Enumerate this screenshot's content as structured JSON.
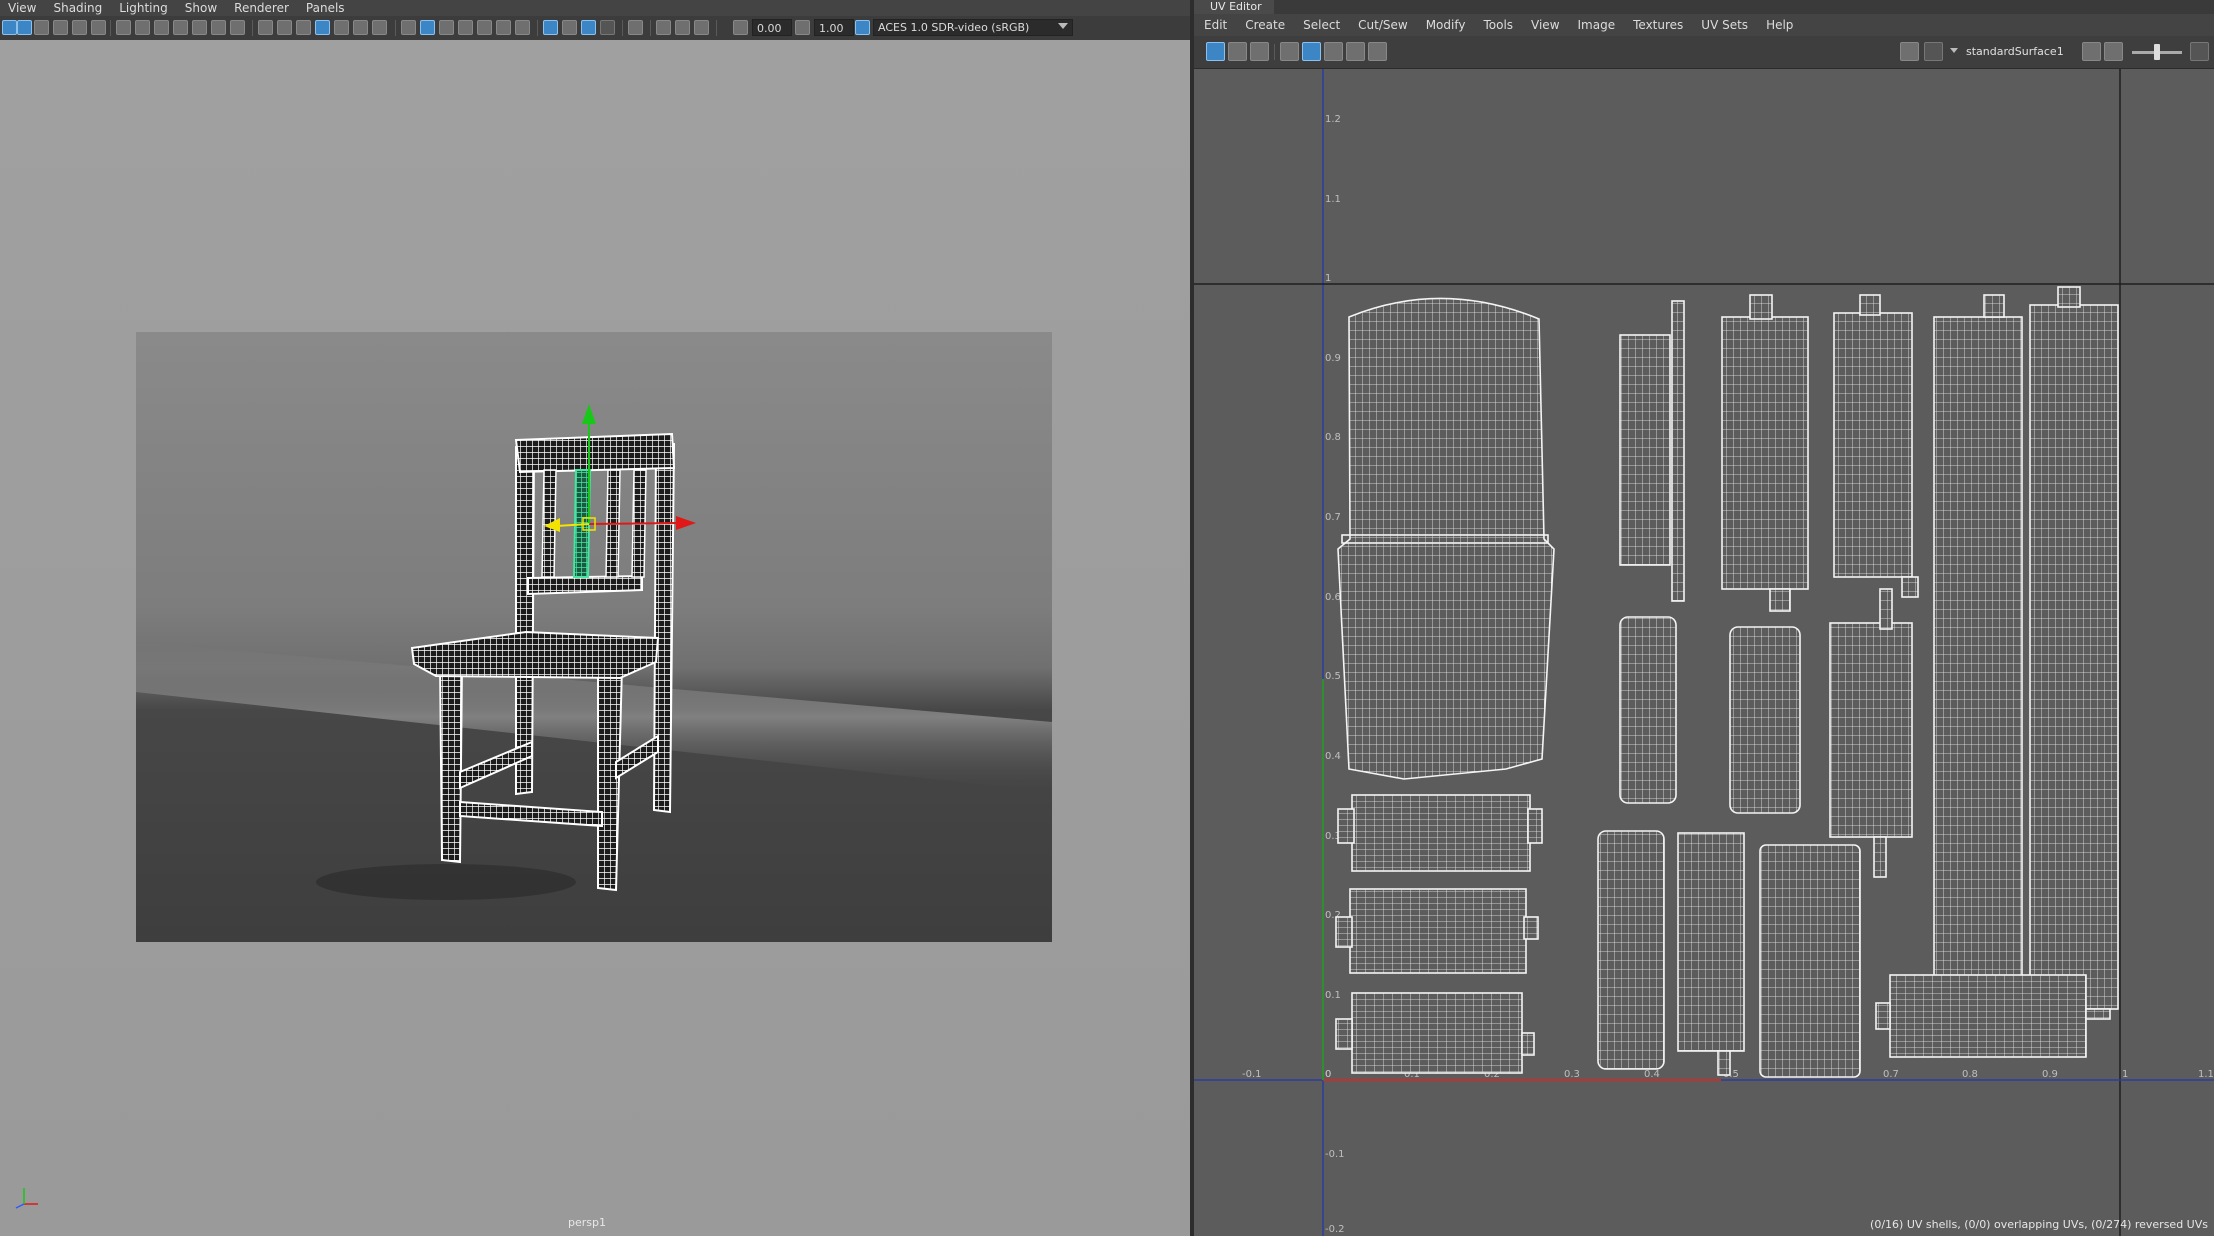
{
  "viewport": {
    "menus": [
      "View",
      "Shading",
      "Lighting",
      "Show",
      "Renderer",
      "Panels"
    ],
    "exposure_value": "0.00",
    "gamma_value": "1.00",
    "colorspace_label": "ACES 1.0 SDR-video (sRGB)",
    "camera_label": "persp1"
  },
  "uv_editor": {
    "title": "UV Editor",
    "menus": [
      "Edit",
      "Create",
      "Select",
      "Cut/Sew",
      "Modify",
      "Tools",
      "View",
      "Image",
      "Textures",
      "UV Sets",
      "Help"
    ],
    "shader_name": "standardSurface1",
    "u_axis_labels": [
      "-0.1",
      "0",
      "0.1",
      "0.2",
      "0.3",
      "0.4",
      "0.5",
      "0.6",
      "0.7",
      "0.8",
      "0.9",
      "1",
      "1.1"
    ],
    "v_axis_labels": [
      "1.2",
      "1.1",
      "1",
      "0.9",
      "0.8",
      "0.7",
      "0.6",
      "0.5",
      "0.4",
      "0.3",
      "0.2",
      "0.1",
      "0",
      "-0.1",
      "-0.2"
    ],
    "status_text": "(0/16) UV shells, (0/0) overlapping UVs, (0/274) reversed UVs"
  },
  "colors": {
    "grid_u_axis": "#c23030",
    "grid_v_axis": "#2f8f2f",
    "grid_line": "#2b3d9e",
    "selection_green": "#44e6a2",
    "manip_red": "#e01818",
    "manip_green": "#18c818",
    "manip_yellow": "#f2e400",
    "wireframe": "#ffffff"
  }
}
